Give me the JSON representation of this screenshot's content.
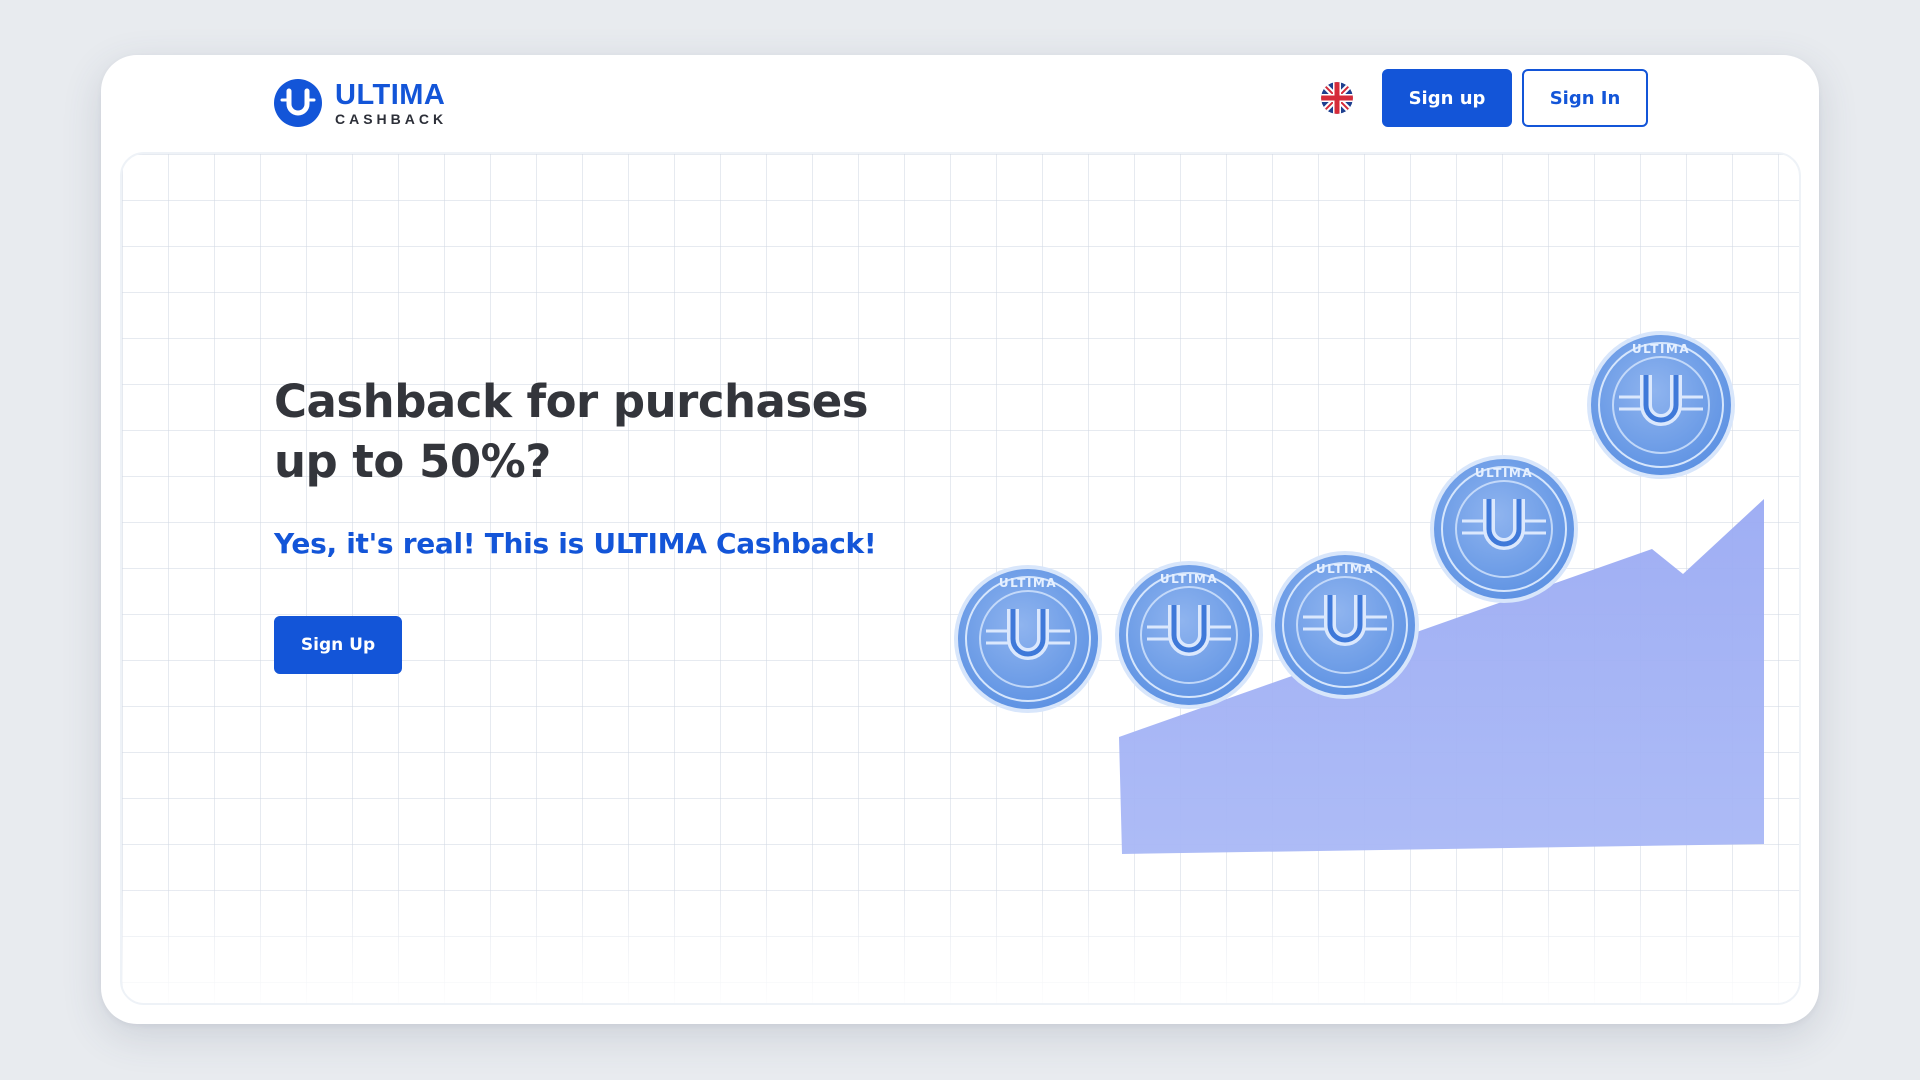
{
  "brand": {
    "name": "ULTIMA",
    "subtitle": "CASHBACK",
    "logo_letter": "U",
    "primary_color": "#1355d8",
    "text_color": "#33353b"
  },
  "header": {
    "language_icon": "uk-flag-icon",
    "signup_label": "Sign up",
    "signin_label": "Sign In"
  },
  "hero": {
    "title": "Cashback for purchases up to 50%?",
    "subtitle": "Yes, it's real! This is ULTIMA Cashback!",
    "cta_label": "Sign Up",
    "illustration": {
      "coin_count": 5,
      "coin_text": "ULTIMA",
      "area_color": "#a3b3f5"
    }
  }
}
